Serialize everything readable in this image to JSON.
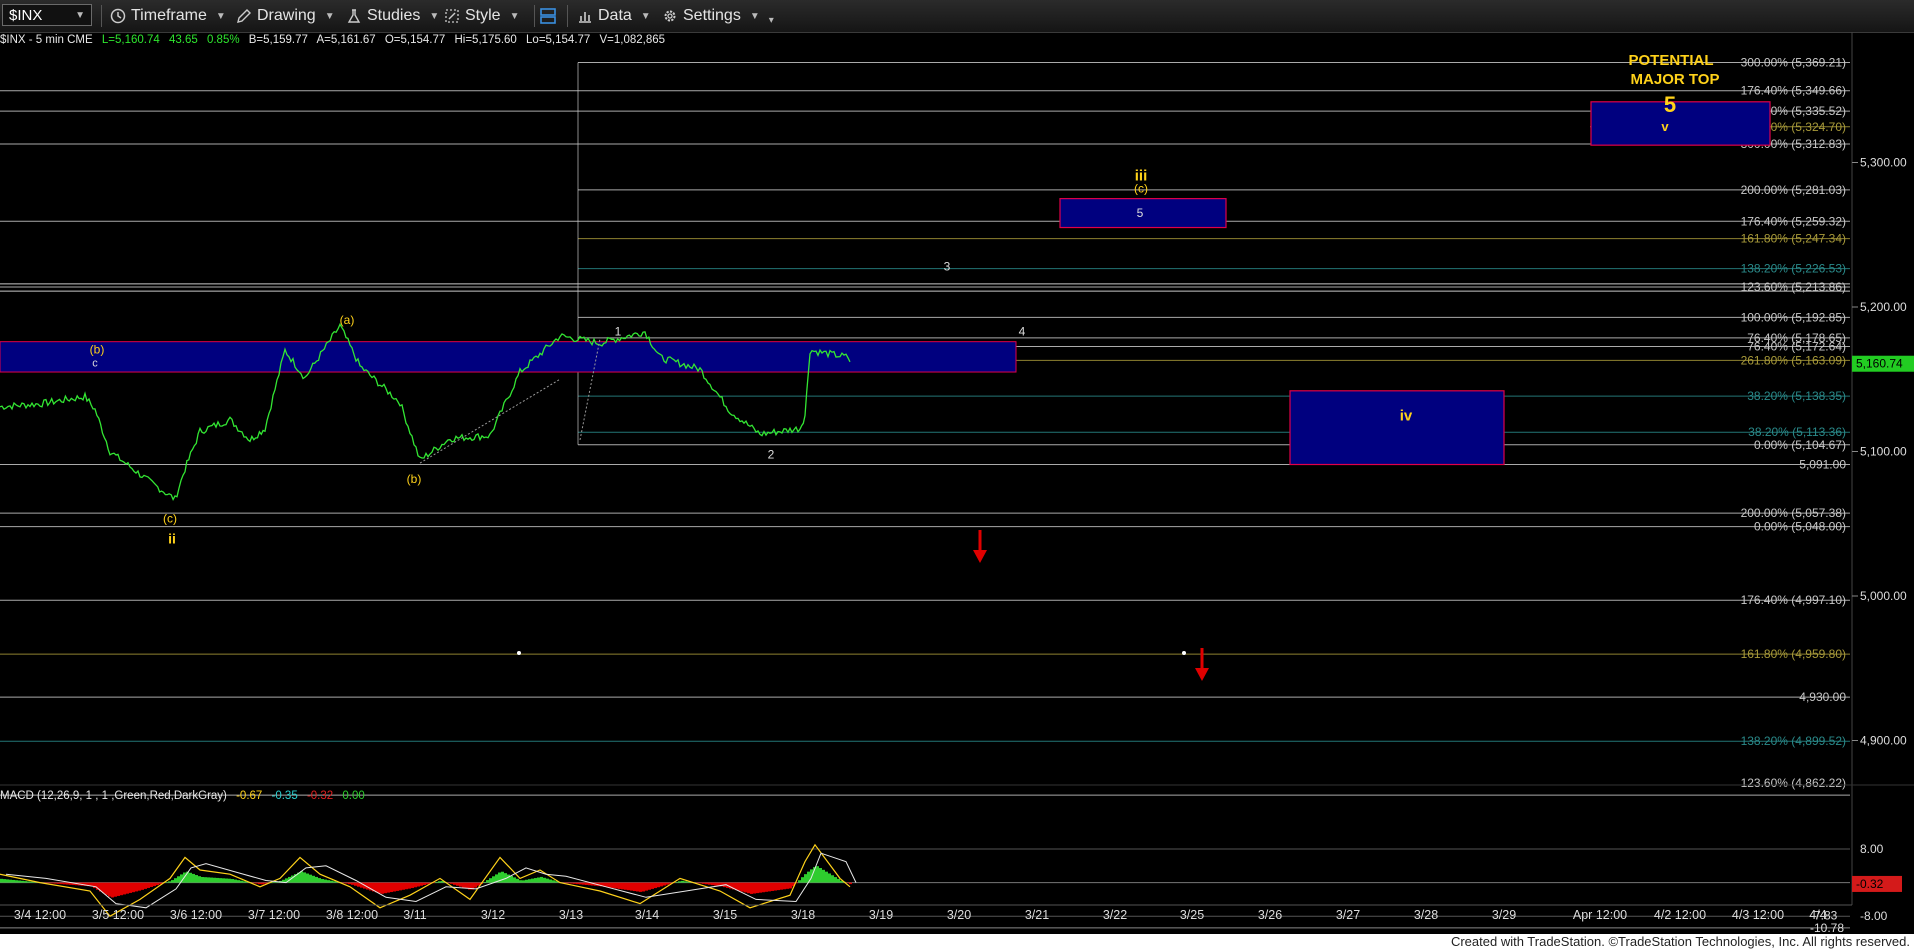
{
  "toolbar": {
    "symbol": "$INX",
    "timeframe": "Timeframe",
    "drawing": "Drawing",
    "studies": "Studies",
    "style": "Style",
    "data": "Data",
    "settings": "Settings"
  },
  "quote": {
    "symbol_interval": "$INX - 5 min  CME",
    "last": "L=5,160.74",
    "change": "43.65",
    "change_pct": "0.85%",
    "bid": "B=5,159.77",
    "ask": "A=5,161.67",
    "open": "O=5,154.77",
    "high": "Hi=5,175.60",
    "low": "Lo=5,154.77",
    "volume": "V=1,082,865"
  },
  "macd": {
    "label": "MACD (12,26,9, 1 , 1 ,Green,Red,DarkGray)",
    "v1": "-0.67",
    "v2": "-0.35",
    "v3": "-0.32",
    "v4": "0.00"
  },
  "colors": {
    "price": "#33e633",
    "blue_box": "#00007f",
    "box_border": "#e0004a",
    "wave_yellow": "#ffd21a",
    "fib_white": "#c8c8c8",
    "fib_teal": "#2a8a8a",
    "fib_olive": "#a89a3a",
    "arrow_red": "#e00000",
    "macd_green": "#2ecc2e",
    "macd_red": "#e00000"
  },
  "price_axis": {
    "labels": [
      {
        "text": "5,300.00",
        "price": 5300
      },
      {
        "text": "5,200.00",
        "price": 5200
      },
      {
        "text": "5,100.00",
        "price": 5100
      },
      {
        "text": "5,000.00",
        "price": 5000
      },
      {
        "text": "4,900.00",
        "price": 4900
      }
    ],
    "last_price": "5,160.74",
    "last_value": 5160.74
  },
  "macd_axis": {
    "labels": [
      {
        "text": "8.00",
        "value": 8
      },
      {
        "text": "-8.00",
        "value": -8
      },
      {
        "text": "-7.83",
        "value": -7.83
      },
      {
        "text": "-10.78",
        "value": -10.78
      }
    ],
    "current": "-0.32",
    "current_value": -0.32
  },
  "fib_levels": [
    {
      "text": "300.00% (5,369.21)",
      "price": 5369.21,
      "color": "white"
    },
    {
      "text": "176.40% (5,349.66)",
      "price": 5349.66,
      "color": "white"
    },
    {
      "text": "261.80% (5,335.52)",
      "price": 5335.52,
      "color": "white"
    },
    {
      "text": "161.80% (5,324.70)",
      "price": 5324.7,
      "color": "olive"
    },
    {
      "text": "300.00% (5,312.83)",
      "price": 5312.83,
      "color": "white"
    },
    {
      "text": "200.00% (5,281.03)",
      "price": 5281.03,
      "color": "white"
    },
    {
      "text": "176.40% (5,259.32)",
      "price": 5259.32,
      "color": "white"
    },
    {
      "text": "161.80% (5,247.34)",
      "price": 5247.34,
      "color": "olive"
    },
    {
      "text": "138.20% (5,226.53)",
      "price": 5226.53,
      "color": "teal"
    },
    {
      "text": "123.60% (5,213.86)",
      "price": 5213.86,
      "color": "white"
    },
    {
      "text": "100.00% (5,192.85)",
      "price": 5192.85,
      "color": "white"
    },
    {
      "text": "76.40% (5,178.65)",
      "price": 5178.65,
      "color": "white"
    },
    {
      "text": "76.40% (5,172.64)",
      "price": 5172.64,
      "color": "white"
    },
    {
      "text": "261.80% (5,163.09)",
      "price": 5163.09,
      "color": "olive"
    },
    {
      "text": "38.20% (5,138.35)",
      "price": 5138.35,
      "color": "teal"
    },
    {
      "text": "38.20% (5,113.36)",
      "price": 5113.36,
      "color": "teal"
    },
    {
      "text": "0.00% (5,104.67)",
      "price": 5104.67,
      "color": "white"
    },
    {
      "text": "5,091.00",
      "price": 5091.0,
      "color": "white"
    },
    {
      "text": "200.00% (5,057.38)",
      "price": 5057.38,
      "color": "white"
    },
    {
      "text": "0.00% (5,048.00)",
      "price": 5048.0,
      "color": "white"
    },
    {
      "text": "176.40% (4,997.10)",
      "price": 4997.1,
      "color": "white"
    },
    {
      "text": "161.80% (4,959.80)",
      "price": 4959.8,
      "color": "olive"
    },
    {
      "text": "4,930.00",
      "price": 4930.0,
      "color": "white"
    },
    {
      "text": "138.20% (4,899.52)",
      "price": 4899.52,
      "color": "teal"
    },
    {
      "text": "123.60% (4,862.22)",
      "price": 4862.22,
      "color": "white"
    }
  ],
  "time_axis": [
    "3/4 12:00",
    "3/5 12:00",
    "3/6 12:00",
    "3/7 12:00",
    "3/8 12:00",
    "3/11",
    "3/12",
    "3/13",
    "3/14",
    "3/15",
    "3/18",
    "3/19",
    "3/20",
    "3/21",
    "3/22",
    "3/25",
    "3/26",
    "3/27",
    "3/28",
    "3/29",
    "Apr 12:00",
    "4/2 12:00",
    "4/3 12:00",
    "4/4"
  ],
  "wave_labels": {
    "b_upper": "(b)",
    "c_small": "c",
    "c_low": "(c)",
    "ii": "ii",
    "a_top": "(a)",
    "b_mid": "(b)",
    "one": "1",
    "two": "2",
    "three": "3",
    "four": "4",
    "five": "5",
    "iii": "iii",
    "c_paren": "(c)",
    "iv": "iv",
    "major_line1": "POTENTIAL",
    "major_line2": "MAJOR TOP",
    "major_5": "5",
    "v": "v"
  },
  "footer": "Created with TradeStation. ©TradeStation Technologies, Inc. All rights reserved."
}
